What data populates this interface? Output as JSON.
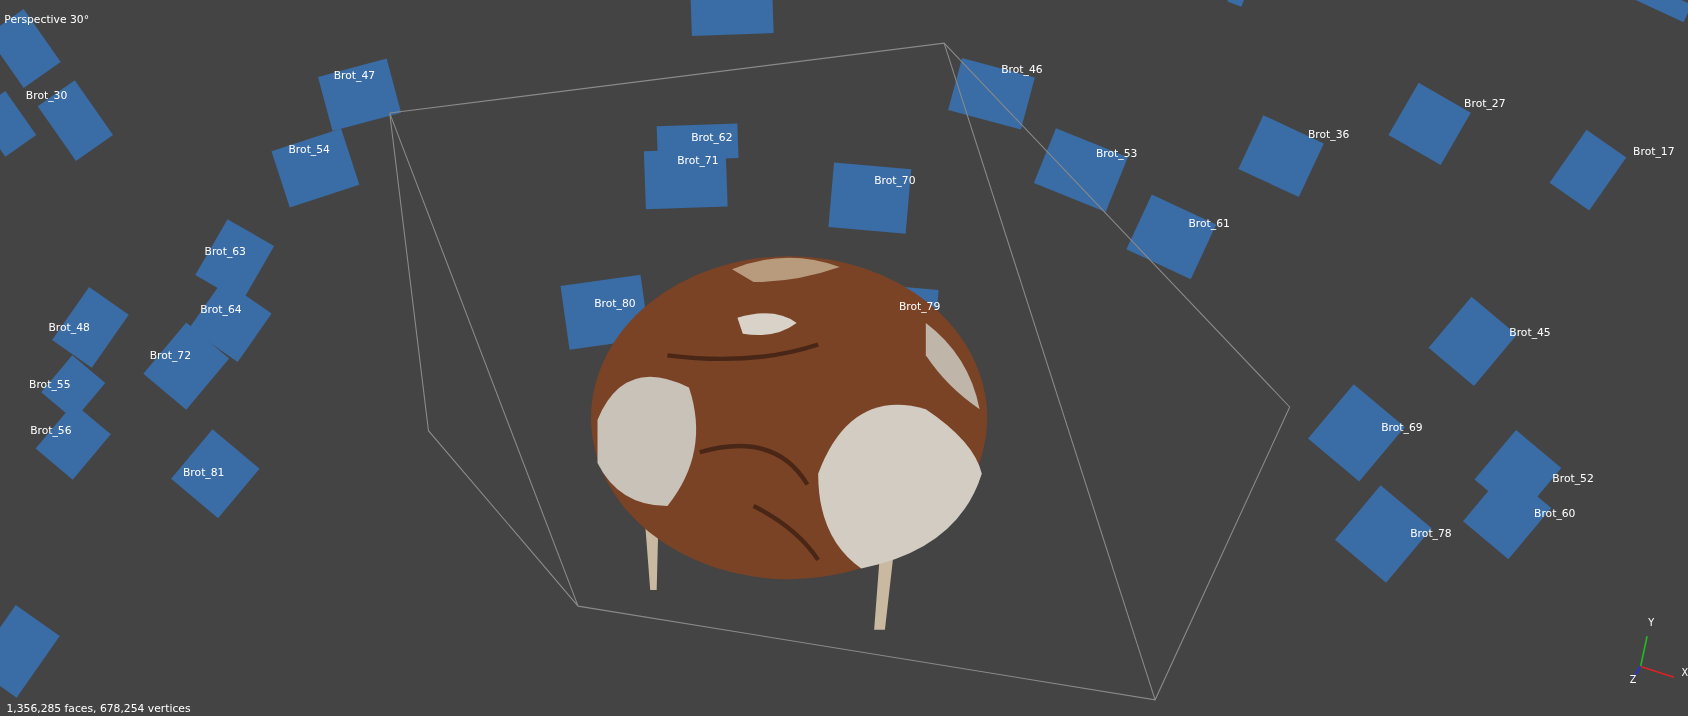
{
  "viewport": {
    "label": "Perspective 30°"
  },
  "cameras": [
    {
      "label": "Brot_30"
    },
    {
      "label": "Brot_47"
    },
    {
      "label": "Brot_54"
    },
    {
      "label": "Brot_46"
    },
    {
      "label": "Brot_62"
    },
    {
      "label": "Brot_71"
    },
    {
      "label": "Brot_70"
    },
    {
      "label": "Brot_53"
    },
    {
      "label": "Brot_36"
    },
    {
      "label": "Brot_27"
    },
    {
      "label": "Brot_17"
    },
    {
      "label": "Brot_61"
    },
    {
      "label": "Brot_63"
    },
    {
      "label": "Brot_64"
    },
    {
      "label": "Brot_48"
    },
    {
      "label": "Brot_72"
    },
    {
      "label": "Brot_55"
    },
    {
      "label": "Brot_56"
    },
    {
      "label": "Brot_81"
    },
    {
      "label": "Brot_80"
    },
    {
      "label": "Brot_79"
    },
    {
      "label": "Brot_45"
    },
    {
      "label": "Brot_69"
    },
    {
      "label": "Brot_52"
    },
    {
      "label": "Brot_60"
    },
    {
      "label": "Brot_78"
    }
  ],
  "axes": [
    {
      "label": "Y"
    },
    {
      "label": "X"
    },
    {
      "label": "Z"
    }
  ],
  "status": "1,356,285 faces, 678,254 vertices"
}
